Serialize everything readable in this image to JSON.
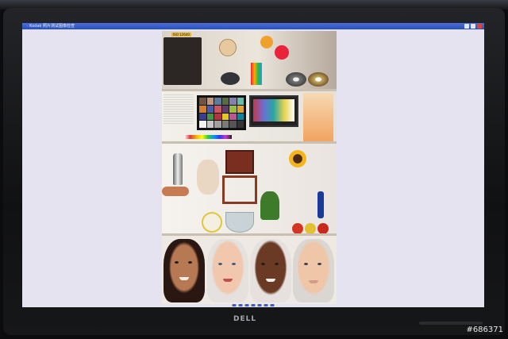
{
  "monitor": {
    "brand_logo": "DELL"
  },
  "window": {
    "title": "· Kodak 照片测试图像检查",
    "controls": [
      "minimize-icon",
      "maximize-icon",
      "close-icon"
    ]
  },
  "image": {
    "label_card": "ISO 12640",
    "subject": "Test chart photo with shelves of objects and four portraits"
  },
  "toolbar": {
    "buttons": [
      "previous-icon",
      "next-icon",
      "zoom-in-icon",
      "zoom-out-icon",
      "fit-icon",
      "rotate-icon",
      "delete-icon"
    ]
  },
  "watermark": "#686371",
  "colors": {
    "bezel": "#161719",
    "screen_bg": "#e6e3f0",
    "titlebar": "#2a4fbf"
  }
}
